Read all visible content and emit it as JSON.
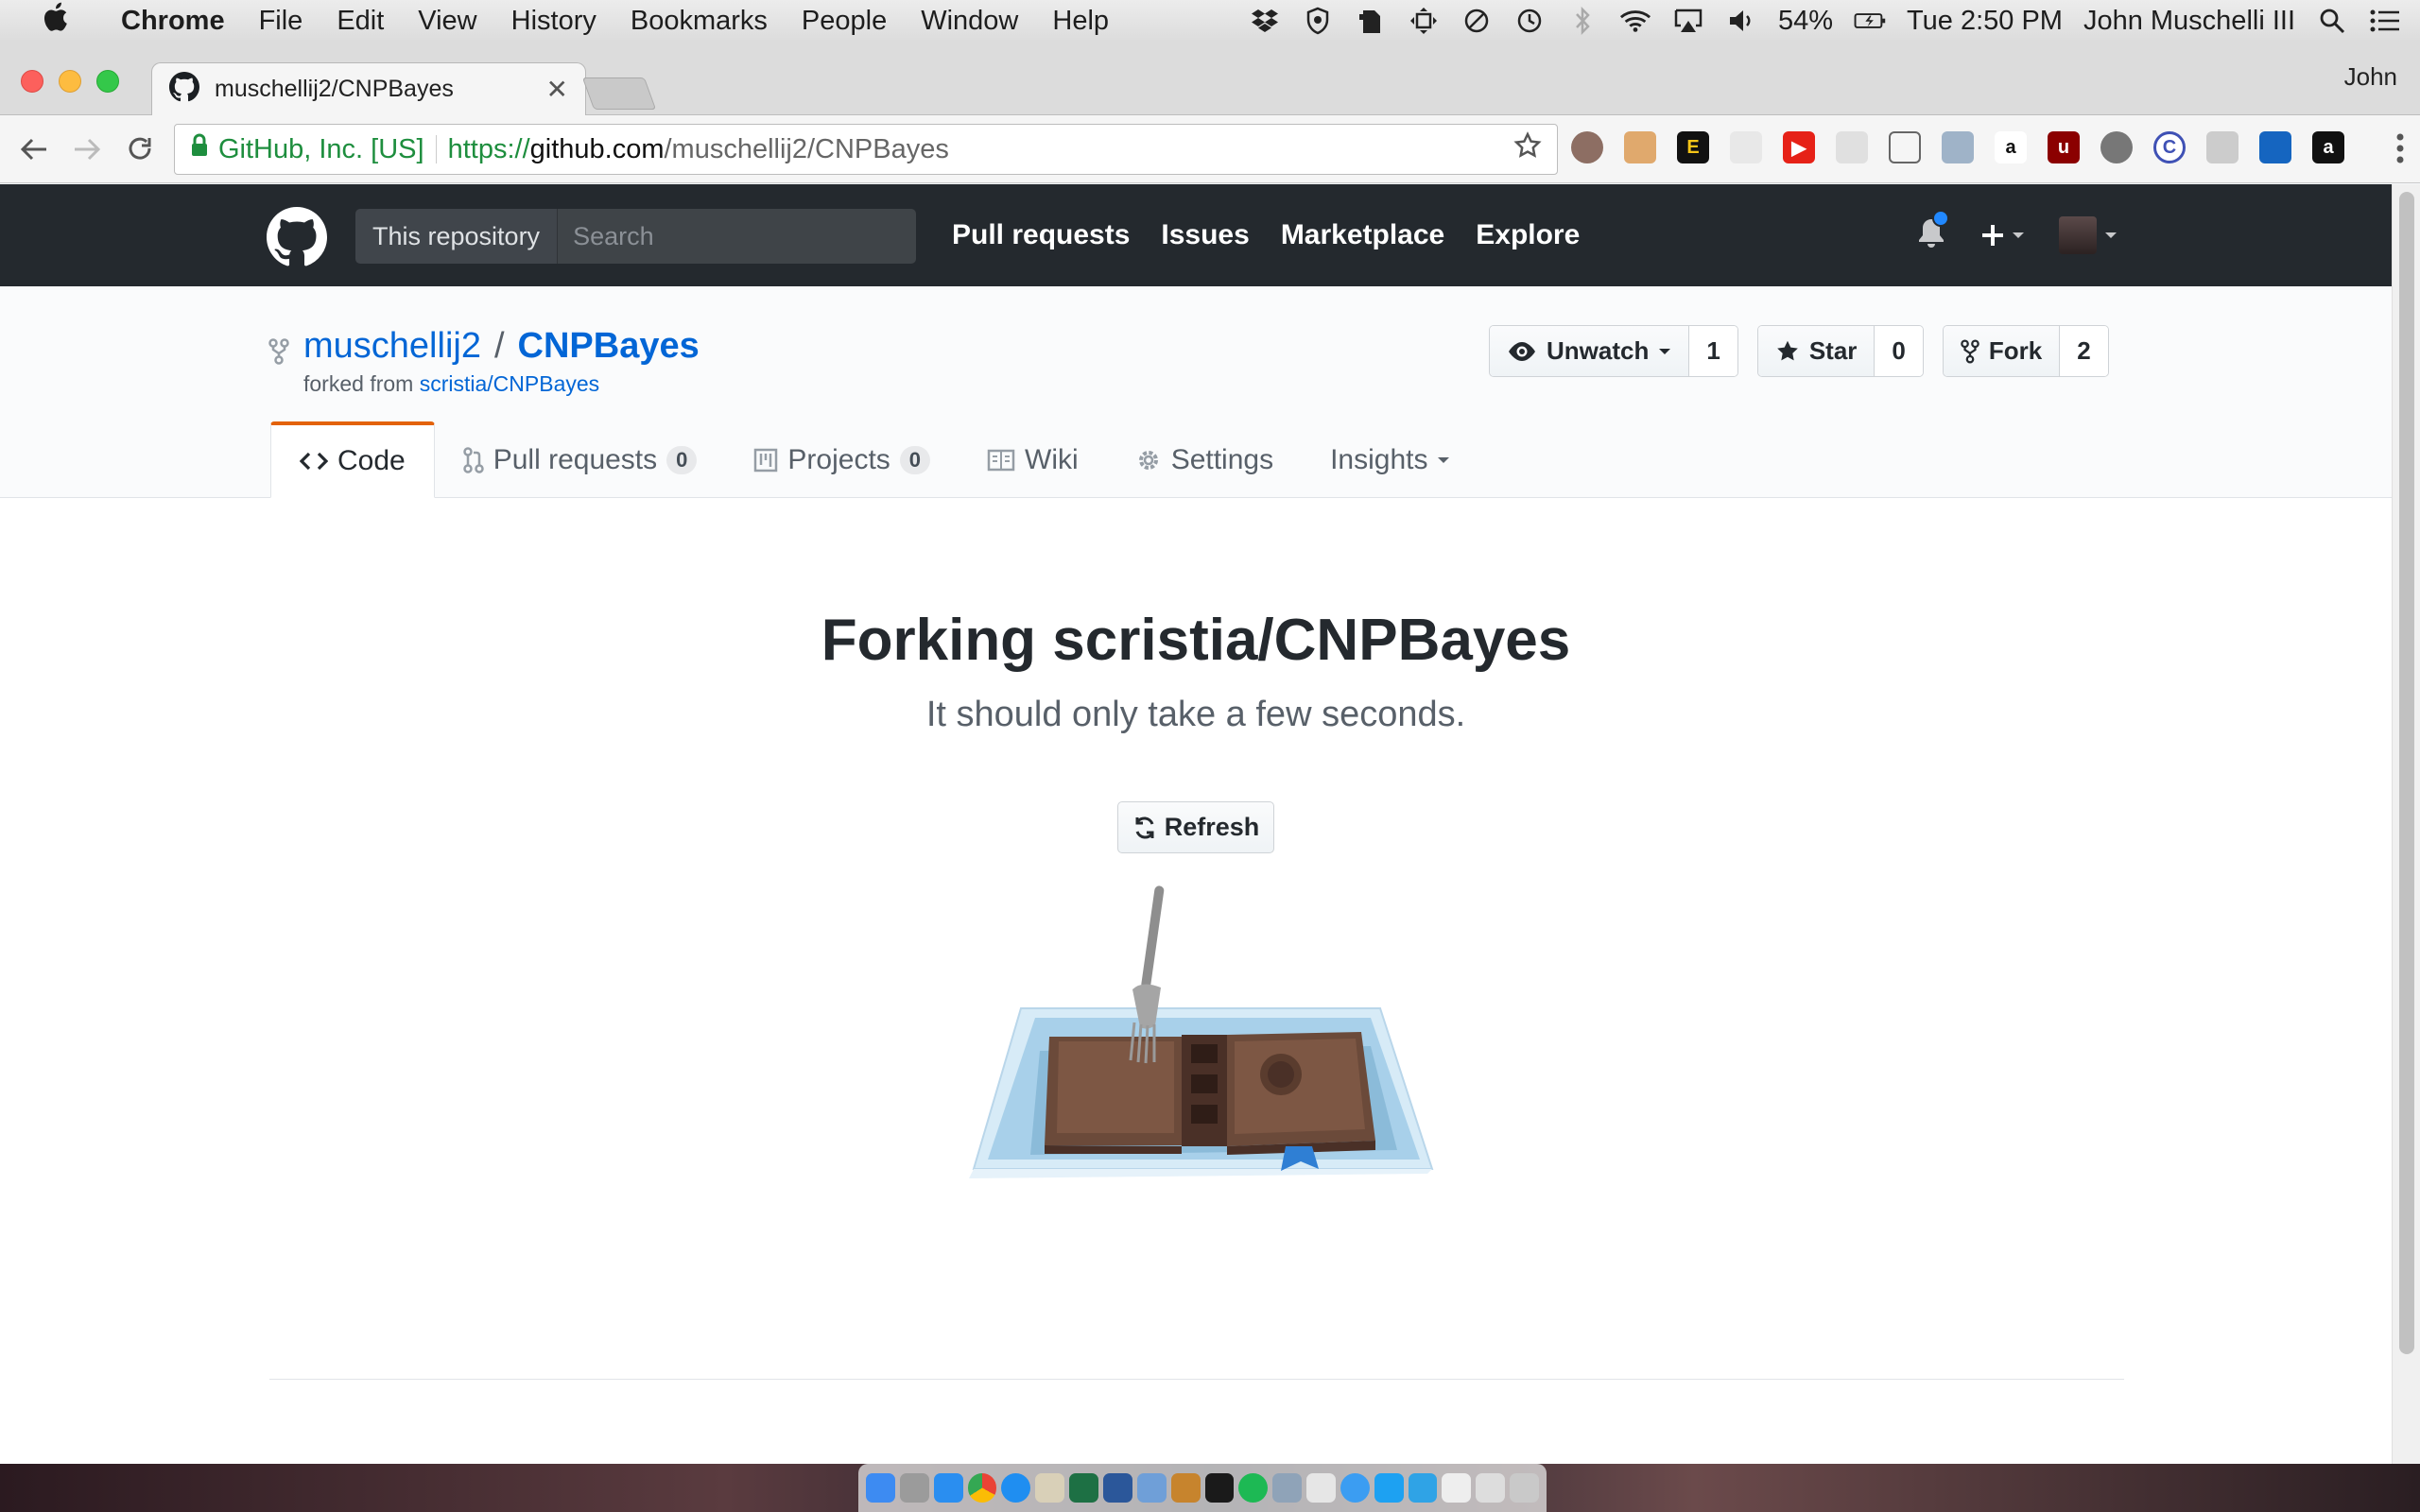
{
  "menubar": {
    "app_name": "Chrome",
    "items": [
      "File",
      "Edit",
      "View",
      "History",
      "Bookmarks",
      "People",
      "Window",
      "Help"
    ],
    "battery": "54%",
    "clock": "Tue 2:50 PM",
    "user": "John Muschelli III"
  },
  "browser": {
    "tab_title": "muschellij2/CNPBayes",
    "profile_name": "John",
    "cert_name": "GitHub, Inc. [US]",
    "url_protocol": "https://",
    "url_host": "github.com",
    "url_path": "/muschellij2/CNPBayes"
  },
  "github_header": {
    "scope_label": "This repository",
    "search_placeholder": "Search",
    "nav": [
      "Pull requests",
      "Issues",
      "Marketplace",
      "Explore"
    ]
  },
  "repo": {
    "owner": "muschellij2",
    "separator": "/",
    "name": "CNPBayes",
    "forked_prefix": "forked from",
    "forked_from": "scristia/CNPBayes",
    "actions": {
      "watch_label": "Unwatch",
      "watch_count": "1",
      "star_label": "Star",
      "star_count": "0",
      "fork_label": "Fork",
      "fork_count": "2"
    },
    "tabs": {
      "code": "Code",
      "pulls": "Pull requests",
      "pulls_count": "0",
      "projects": "Projects",
      "projects_count": "0",
      "wiki": "Wiki",
      "settings": "Settings",
      "insights": "Insights"
    }
  },
  "main": {
    "title": "Forking scristia/CNPBayes",
    "subtitle": "It should only take a few seconds.",
    "refresh_label": "Refresh"
  },
  "colors": {
    "github_dark": "#24292e",
    "link_blue": "#0366d6",
    "tab_accent": "#e36209",
    "notification_blue": "#2188ff"
  }
}
